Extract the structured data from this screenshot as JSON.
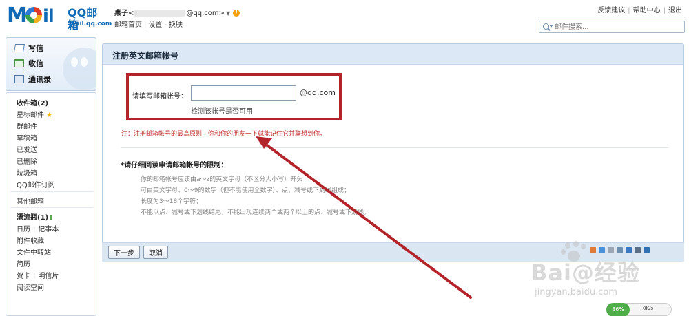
{
  "header": {
    "logo_mail": "Mail",
    "logo_brand": "QQ邮箱",
    "logo_domain": "mail.qq.com",
    "user_name": "桌子<",
    "user_email_suffix": "@qq.com>",
    "user_dropdown": "▼",
    "user_warning": "!",
    "links_home": "邮箱首页",
    "links_settings": "设置",
    "links_switch": "换肤",
    "top_feedback": "反馈建议",
    "top_help": "帮助中心",
    "top_logout": "退出",
    "search_placeholder": "邮件搜索..."
  },
  "sidebar": {
    "quick": [
      {
        "label": "写信",
        "icon": "compose-icon"
      },
      {
        "label": "收信",
        "icon": "inbox-icon"
      },
      {
        "label": "通讯录",
        "icon": "contacts-icon"
      }
    ],
    "folders": {
      "inbox": "收件箱(2)",
      "starred": "星标邮件",
      "group": "群邮件",
      "drafts": "草稿箱",
      "sent": "已发送",
      "deleted": "已删除",
      "spam": "垃圾箱",
      "subscription": "QQ邮件订阅",
      "other": "其他邮箱",
      "bottle": "漂流瓶(1)",
      "calendar": "日历",
      "notes": "记事本",
      "attachments": "附件收藏",
      "file_transfer": "文件中转站",
      "resume": "简历",
      "cards": "贺卡",
      "postcards": "明信片",
      "reading": "阅读空间"
    }
  },
  "main": {
    "title": "注册英文邮箱帐号",
    "form_label": "请填写邮箱帐号：",
    "input_value": "",
    "domain_suffix": "@qq.com",
    "check_link": "检测该帐号是否可用",
    "rule_note": "注：注册邮箱帐号的最高原则 - 你和你的朋友一下就能记住它并联想到你。",
    "restrict_title": "*请仔细阅读申请邮箱帐号的限制：",
    "rules": [
      "你的邮箱帐号应该由a～z的英文字母（不区分大小写）开头",
      "可由英文字母、0～9的数字（但不能使用全数字）、点、减号或下划线组成；",
      "长度为3～18个字符；",
      "不能以点、减号或下划线结尾，不能出现连续两个或两个以上的点、减号或下划线。"
    ],
    "btn_next": "下一步",
    "btn_cancel": "取消"
  },
  "watermark": {
    "text": "Bai@经验",
    "url": "jingyan.baidu.com"
  },
  "speed_widget": {
    "percent": "86%",
    "speed": "0K/s"
  },
  "colors": {
    "annotation_red": "#b3242a",
    "brand_blue": "#0f69b5",
    "title_bar": "#dce8f5"
  }
}
